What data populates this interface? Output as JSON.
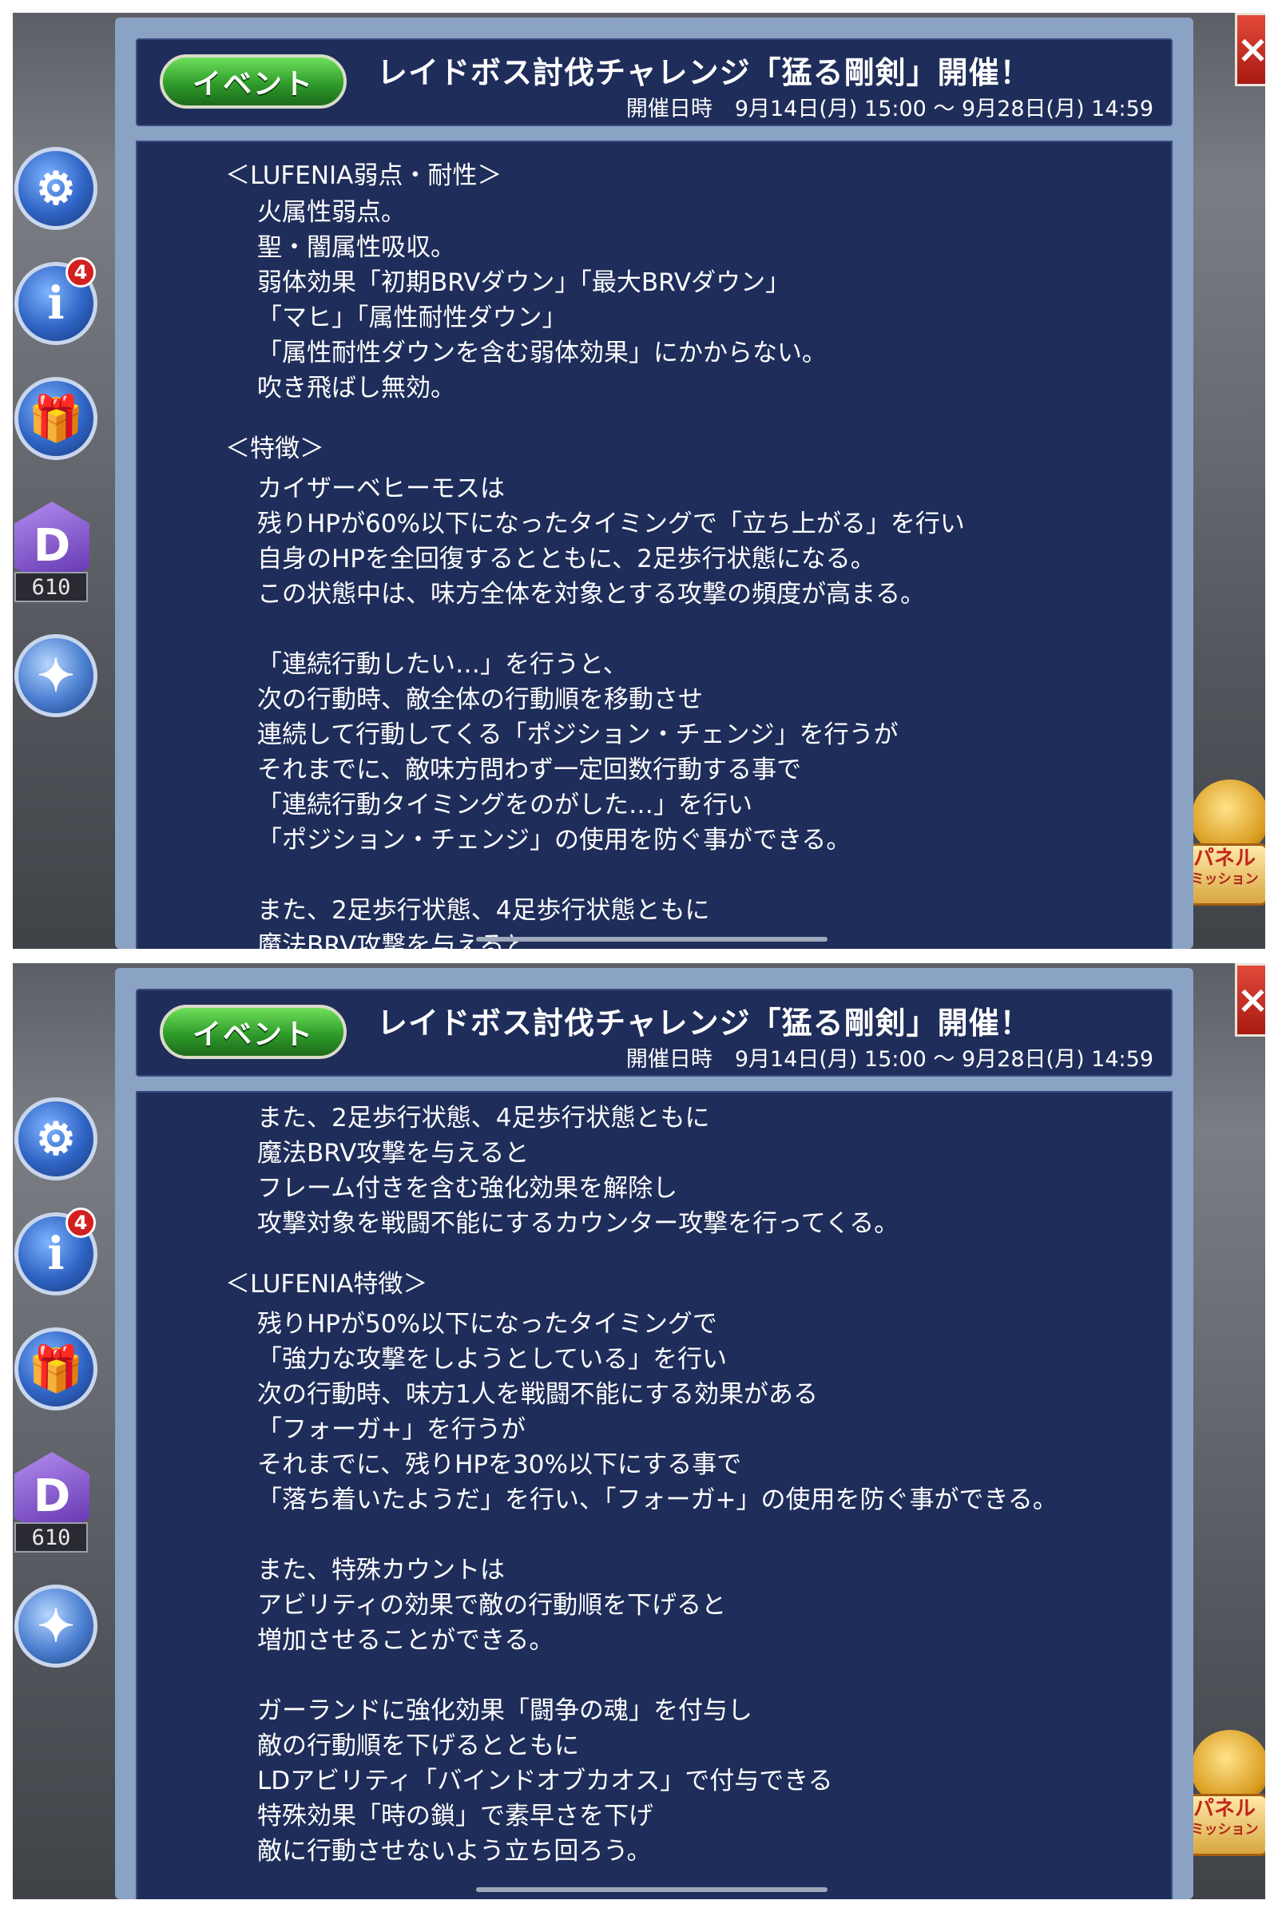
{
  "sidebar": {
    "notification_count": "4",
    "crystal_count": "610",
    "icons": [
      "gear-icon",
      "info-icon",
      "gift-icon",
      "crystal-icon",
      "chocobo-icon"
    ]
  },
  "close_label": "×",
  "panel_mission": {
    "line1": "パネル",
    "line2": "ミッション"
  },
  "dialog": {
    "tag": "イベント",
    "title": "レイドボス討伐チャレンジ「猛る剛剣」開催！",
    "date_label": "開催日時",
    "date_value": "9月14日(月) 15:00 〜 9月28日(月) 14:59"
  },
  "page1_lines": [
    "＜LUFENIA弱点・耐性＞",
    "火属性弱点。",
    "聖・闇属性吸収。",
    "弱体効果「初期BRVダウン」「最大BRVダウン」",
    "「マヒ」「属性耐性ダウン」",
    "「属性耐性ダウンを含む弱体効果」にかからない。",
    "吹き飛ばし無効。",
    "＜特徴＞",
    "カイザーベヒーモスは",
    "残りHPが60%以下になったタイミングで「立ち上がる」を行い",
    "自身のHPを全回復するとともに、2足歩行状態になる。",
    "この状態中は、味方全体を対象とする攻撃の頻度が高まる。",
    "「連続行動したい…」を行うと、",
    "次の行動時、敵全体の行動順を移動させ",
    "連続して行動してくる「ポジション・チェンジ」を行うが",
    "それまでに、敵味方問わず一定回数行動する事で",
    "「連続行動タイミングをのがした…」を行い",
    "「ポジション・チェンジ」の使用を防ぐ事ができる。",
    "また、2足歩行状態、4足歩行状態ともに",
    "魔法BRV攻撃を与えると"
  ],
  "page2_lines": [
    "また、2足歩行状態、4足歩行状態ともに",
    "魔法BRV攻撃を与えると",
    "フレーム付きを含む強化効果を解除し",
    "攻撃対象を戦闘不能にするカウンター攻撃を行ってくる。",
    "＜LUFENIA特徴＞",
    "残りHPが50%以下になったタイミングで",
    "「強力な攻撃をしようとしている」を行い",
    "次の行動時、味方1人を戦闘不能にする効果がある",
    "「フォーガ+」を行うが",
    "それまでに、残りHPを30%以下にする事で",
    "「落ち着いたようだ」を行い、「フォーガ+」の使用を防ぐ事ができる。",
    "また、特殊カウントは",
    "アビリティの効果で敵の行動順を下げると",
    "増加させることができる。",
    "ガーランドに強化効果「闘争の魂」を付与し",
    "敵の行動順を下げるとともに",
    "LDアビリティ「バインドオブカオス」で付与できる",
    "特殊効果「時の鎖」で素早さを下げ",
    "敵に行動させないよう立ち回ろう。"
  ]
}
